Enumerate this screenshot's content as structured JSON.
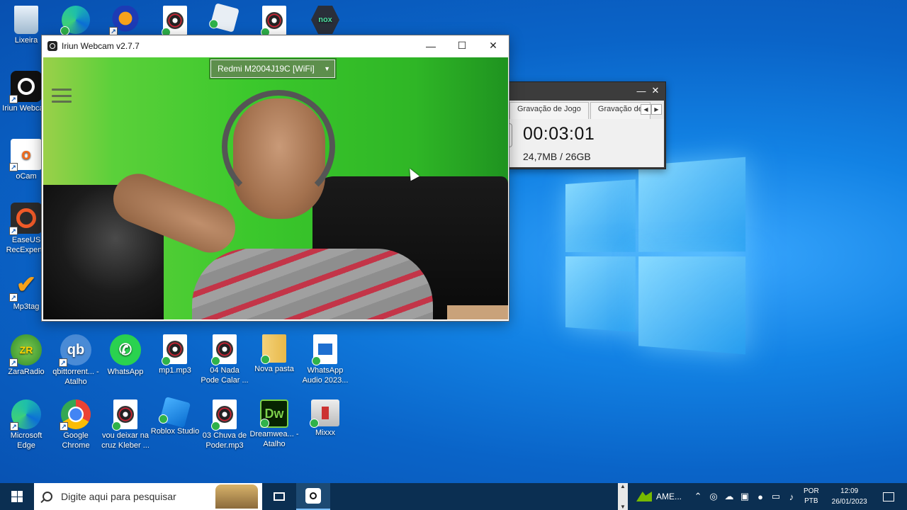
{
  "desktop": {
    "icons": [
      {
        "label": "Lixeira"
      },
      {
        "label": ""
      },
      {
        "label": ""
      },
      {
        "label": ""
      },
      {
        "label": ""
      },
      {
        "label": ""
      },
      {
        "label": ""
      },
      {
        "label": "Iriun Webcam"
      },
      {
        "label": "oCam"
      },
      {
        "label": "EaseUS RecExperts"
      },
      {
        "label": "Mp3tag"
      },
      {
        "label": "ZaraRadio"
      },
      {
        "label": "qbittorrent... - Atalho"
      },
      {
        "label": "WhatsApp"
      },
      {
        "label": "mp1.mp3"
      },
      {
        "label": "04 Nada Pode Calar ..."
      },
      {
        "label": "Nova pasta"
      },
      {
        "label": "WhatsApp Audio 2023..."
      },
      {
        "label": "Microsoft Edge"
      },
      {
        "label": "Google Chrome"
      },
      {
        "label": "vou deixar na cruz Kleber ..."
      },
      {
        "label": "Roblox Studio"
      },
      {
        "label": "03 Chuva de Poder.mp3"
      },
      {
        "label": "Dreamwea... - Atalho"
      },
      {
        "label": "Mixxx"
      }
    ]
  },
  "iriun_window": {
    "title": "Iriun Webcam v2.7.7",
    "minimize": "—",
    "maximize": "☐",
    "close": "✕",
    "device_select": "Redmi M2004J19C [WiFi]"
  },
  "ocam": {
    "minimize": "—",
    "close": "✕",
    "tabs": [
      "Gravação de Jogo",
      "Gravação de"
    ],
    "time": "00:03:01",
    "size": "24,7MB / 26GB"
  },
  "taskbar": {
    "search_placeholder": "Digite aqui para pesquisar",
    "nvidia_label": "AME...",
    "lang_top": "POR",
    "lang_bottom": "PTB",
    "time": "12:09",
    "date": "26/01/2023"
  },
  "colors": {
    "taskbar": "#0b2f52",
    "desktop": "#0a64c8",
    "ocam_bg": "#3c3c3c"
  }
}
